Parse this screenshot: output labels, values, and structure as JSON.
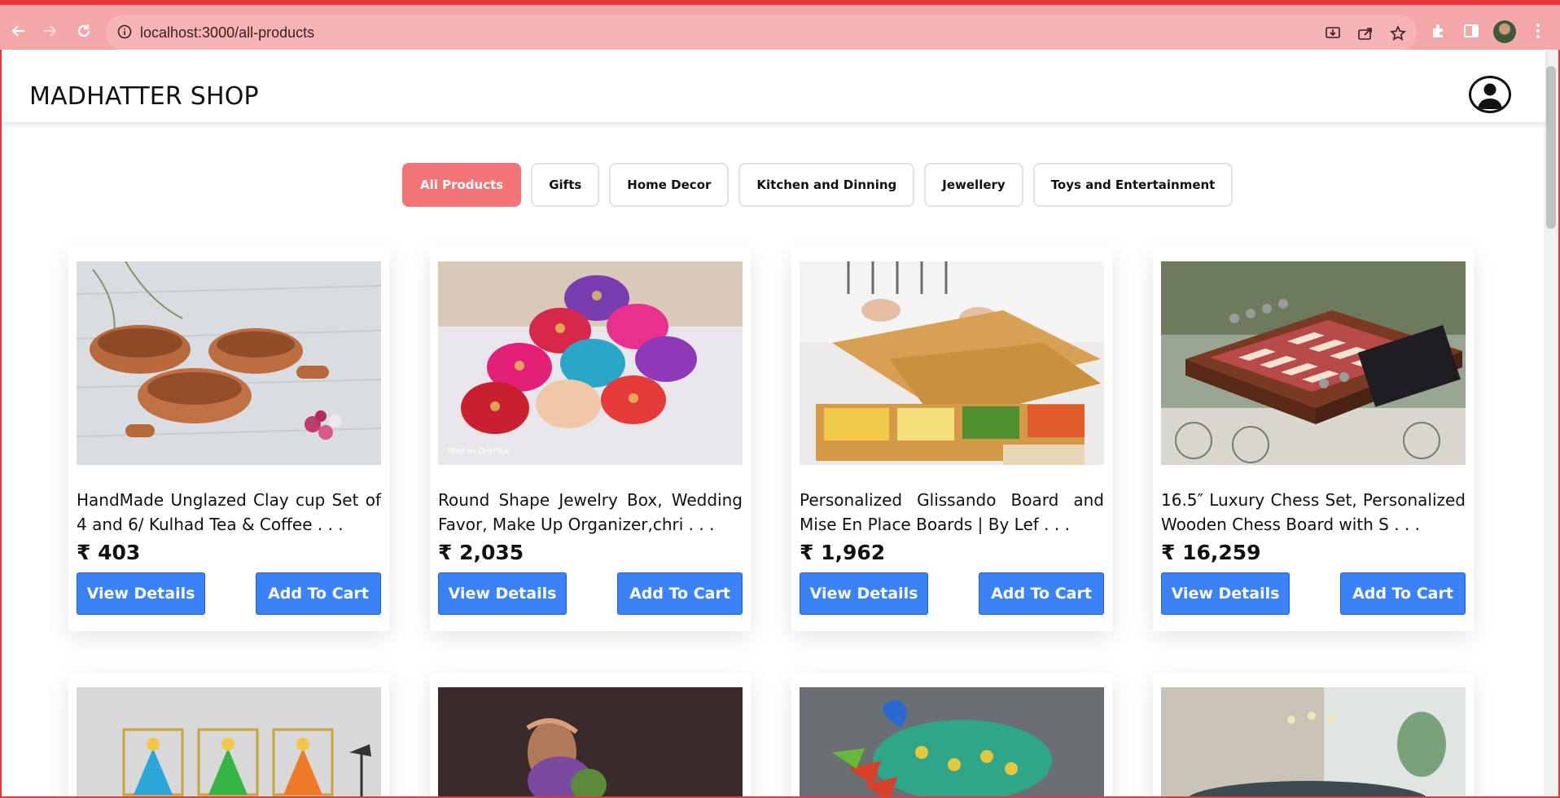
{
  "browser": {
    "url": "localhost:3000/all-products",
    "toolbar_icons": [
      "back-icon",
      "forward-icon",
      "reload-icon",
      "install-icon",
      "share-icon",
      "bookmark-star-icon",
      "extensions-icon",
      "side-panel-icon",
      "profile-avatar",
      "menu-icon"
    ]
  },
  "header": {
    "brand": "MADHATTER SHOP",
    "user_icon": "user-account-icon"
  },
  "filters": [
    {
      "label": "All Products",
      "active": true
    },
    {
      "label": "Gifts",
      "active": false
    },
    {
      "label": "Home Decor",
      "active": false
    },
    {
      "label": "Kitchen and Dinning",
      "active": false
    },
    {
      "label": "Jewellery",
      "active": false
    },
    {
      "label": "Toys and Entertainment",
      "active": false
    }
  ],
  "products": [
    {
      "title": "HandMade Unglazed Clay cup Set of 4 and 6/ Kulhad Tea & Coffee . . .",
      "price": "₹ 403",
      "view_label": "View Details",
      "cart_label": "Add To Cart"
    },
    {
      "title": "Round Shape Jewelry Box, Wedding Favor, Make Up Organizer,chri . . .",
      "price": "₹ 2,035",
      "view_label": "View Details",
      "cart_label": "Add To Cart"
    },
    {
      "title": "Personalized Glissando Board and Mise En Place Boards | By Lef . . .",
      "price": "₹ 1,962",
      "view_label": "View Details",
      "cart_label": "Add To Cart"
    },
    {
      "title": "16.5″ Luxury Chess Set, Personalized Wooden Chess Board with S . . .",
      "price": "₹ 16,259",
      "view_label": "View Details",
      "cart_label": "Add To Cart"
    }
  ],
  "product_image_overlay": "Shot on OnePlus",
  "colors": {
    "active_filter": "#f37476",
    "button_blue": "#3b82f6",
    "chrome": "#f4a7a9"
  }
}
